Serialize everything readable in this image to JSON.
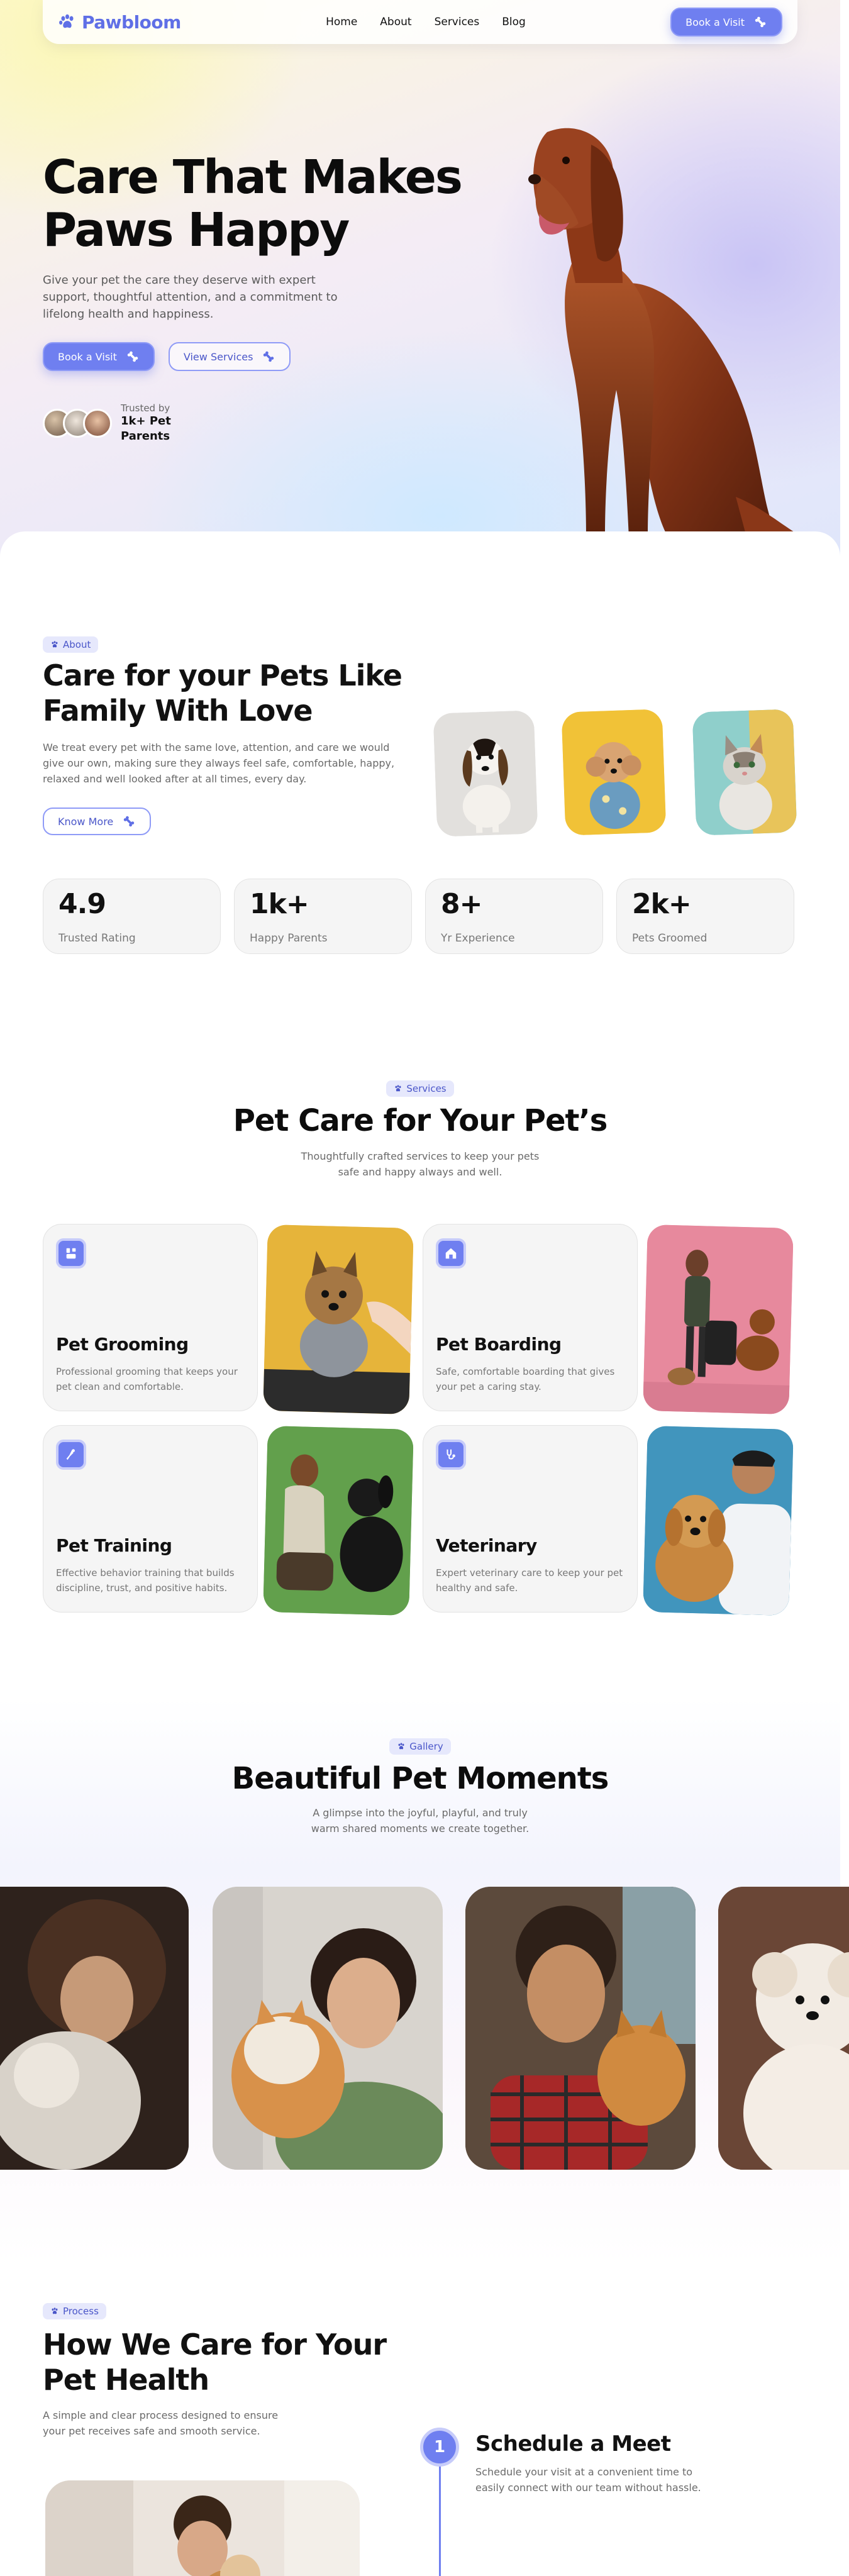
{
  "brand": {
    "name": "Pawbloom",
    "accent": "#6f7ff0"
  },
  "nav": {
    "links": [
      "Home",
      "About",
      "Services",
      "Blog"
    ],
    "cta": "Book a Visit"
  },
  "hero": {
    "title": "Care That Makes Paws Happy",
    "subtitle": "Give your pet the care they deserve with expert support, thoughtful attention, and a commitment to lifelong health and happiness.",
    "primary_cta": "Book a Visit",
    "secondary_cta": "View Services",
    "trusted_label": "Trusted by",
    "trusted_count": "1k+ Pet Parents"
  },
  "about": {
    "pill": "About",
    "title": "Care for your Pets Like Family With Love",
    "text": "We treat every pet with the same love, attention, and care we would give our own, making sure they always feel safe, comfortable, happy, relaxed and well looked after at all times, every day.",
    "cta": "Know More",
    "stats": [
      {
        "value": "4.9",
        "label": "Trusted Rating"
      },
      {
        "value": "1k+",
        "label": "Happy Parents"
      },
      {
        "value": "8+",
        "label": "Yr Experience"
      },
      {
        "value": "2k+",
        "label": "Pets Groomed"
      }
    ]
  },
  "services": {
    "pill": "Services",
    "title": "Pet Care for Your Pet’s",
    "subtitle": "Thoughtfully crafted services to keep your pets safe and happy always and well.",
    "items": [
      {
        "name": "Pet Grooming",
        "desc": "Professional grooming that keeps your pet clean and comfortable.",
        "icon": "grooming-icon"
      },
      {
        "name": "Pet Boarding",
        "desc": "Safe, comfortable boarding that gives your pet a caring stay.",
        "icon": "house-icon"
      },
      {
        "name": "Pet Training",
        "desc": "Effective behavior training that builds discipline, trust, and positive habits.",
        "icon": "training-icon"
      },
      {
        "name": "Veterinary",
        "desc": "Expert veterinary care to keep your pet healthy and safe.",
        "icon": "stethoscope-icon"
      }
    ]
  },
  "gallery": {
    "pill": "Gallery",
    "title": "Beautiful Pet Moments",
    "subtitle": "A glimpse into the joyful, playful, and truly warm shared moments we create together."
  },
  "process": {
    "pill": "Process",
    "title": "How We Care for Your Pet Health",
    "subtitle": "A simple and clear process designed to ensure your pet receives safe and smooth service.",
    "steps": [
      {
        "number": "1",
        "title": "Schedule a Meet",
        "desc": "Schedule your visit at a convenient time to easily connect with our team without hassle."
      }
    ]
  }
}
